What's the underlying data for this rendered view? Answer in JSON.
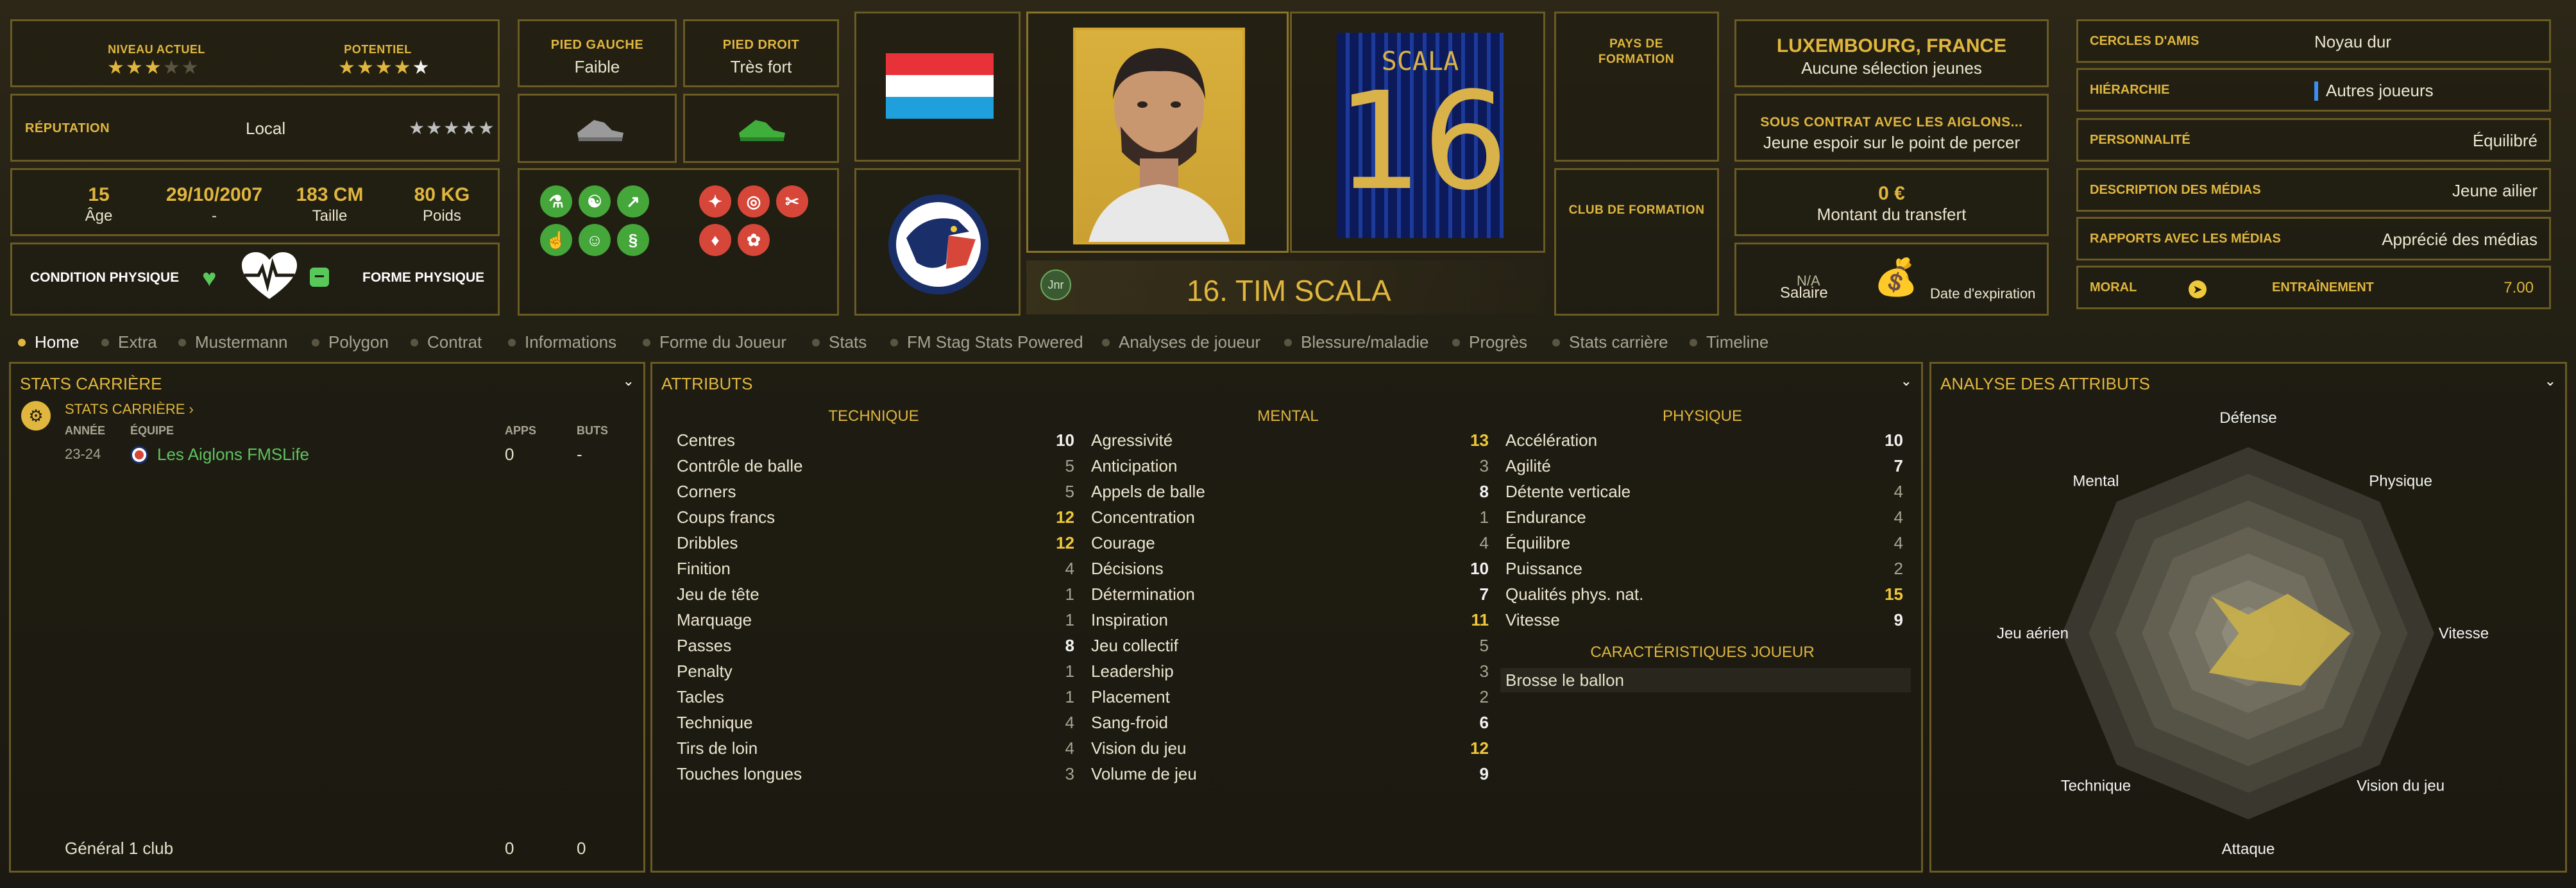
{
  "profile": {
    "current_level_label": "NIVEAU ACTUEL",
    "potential_label": "POTENTIEL",
    "current_level_stars": 3,
    "potential_stars": 4.5,
    "reputation_label": "RÉPUTATION",
    "reputation_value": "Local",
    "reputation_stars": 0,
    "age_value": "15",
    "age_label": "Âge",
    "dob_value": "29/10/2007",
    "dob_label": "-",
    "height_value": "183 CM",
    "height_label": "Taille",
    "weight_value": "80 KG",
    "weight_label": "Poids",
    "condition_label": "CONDITION PHYSIQUE",
    "form_label": "FORME PHYSIQUE",
    "left_foot_label": "PIED GAUCHE",
    "left_foot_value": "Faible",
    "right_foot_label": "PIED DROIT",
    "right_foot_value": "Très fort",
    "training_pref_label": "PAYS DE FORMATION",
    "club_training_label": "CLUB DE FORMATION",
    "nationality_title": "LUXEMBOURG, FRANCE",
    "nationality_sub": "Aucune sélection jeunes",
    "contract_title": "SOUS CONTRAT AVEC LES AIGLONS...",
    "contract_sub": "Jeune espoir sur le point de percer",
    "transfer_value": "0 €",
    "transfer_label": "Montant du transfert",
    "salary_value": "N/A",
    "salary_label": "Salaire",
    "expiry_label": "Date d'expiration",
    "player_name": "16. TIM SCALA",
    "badge": "Jnr",
    "shirt_name": "SCALA",
    "shirt_number": "16",
    "club_badge_text": "LES AIGLONS"
  },
  "right_panel": [
    {
      "k": "CERCLES D'AMIS",
      "v": "Noyau dur"
    },
    {
      "k": "HIÉRARCHIE",
      "v": "Autres joueurs"
    },
    {
      "k": "PERSONNALITÉ",
      "v": "Équilibré"
    },
    {
      "k": "DESCRIPTION DES MÉDIAS",
      "v": "Jeune ailier"
    },
    {
      "k": "RAPPORTS AVEC LES MÉDIAS",
      "v": "Apprécié des médias"
    }
  ],
  "moral": {
    "label": "MORAL",
    "training_label": "ENTRAÎNEMENT",
    "training_value": "7.00"
  },
  "tabs": [
    "Home",
    "Extra",
    "Mustermann",
    "Polygon",
    "Contrat",
    "Informations",
    "Forme du Joueur",
    "Stats",
    "FM Stag Stats Powered",
    "Analyses de joueur",
    "Blessure/maladie",
    "Progrès",
    "Stats carrière",
    "Timeline"
  ],
  "career": {
    "title": "STATS CARRIÈRE",
    "sub": "STATS CARRIÈRE",
    "col_year": "ANNÉE",
    "col_team": "ÉQUIPE",
    "col_apps": "APPS",
    "col_goals": "BUTS",
    "rows": [
      {
        "year": "23-24",
        "team": "Les Aiglons FMSLife",
        "apps": "0",
        "goals": "-"
      }
    ],
    "total_label": "Général 1 club",
    "total_apps": "0",
    "total_goals": "0"
  },
  "attributes": {
    "title": "ATTRIBUTS",
    "tech_label": "TECHNIQUE",
    "mental_label": "MENTAL",
    "phys_label": "PHYSIQUE",
    "technique": [
      [
        "Centres",
        "10"
      ],
      [
        "Contrôle de balle",
        "5"
      ],
      [
        "Corners",
        "5"
      ],
      [
        "Coups francs",
        "12"
      ],
      [
        "Dribbles",
        "12"
      ],
      [
        "Finition",
        "4"
      ],
      [
        "Jeu de tête",
        "1"
      ],
      [
        "Marquage",
        "1"
      ],
      [
        "Passes",
        "8"
      ],
      [
        "Penalty",
        "1"
      ],
      [
        "Tacles",
        "1"
      ],
      [
        "Technique",
        "4"
      ],
      [
        "Tirs de loin",
        "4"
      ],
      [
        "Touches longues",
        "3"
      ]
    ],
    "mental": [
      [
        "Agressivité",
        "13"
      ],
      [
        "Anticipation",
        "3"
      ],
      [
        "Appels de balle",
        "8"
      ],
      [
        "Concentration",
        "1"
      ],
      [
        "Courage",
        "4"
      ],
      [
        "Décisions",
        "10"
      ],
      [
        "Détermination",
        "7"
      ],
      [
        "Inspiration",
        "11"
      ],
      [
        "Jeu collectif",
        "5"
      ],
      [
        "Leadership",
        "3"
      ],
      [
        "Placement",
        "2"
      ],
      [
        "Sang-froid",
        "6"
      ],
      [
        "Vision du jeu",
        "12"
      ],
      [
        "Volume de jeu",
        "9"
      ]
    ],
    "physique": [
      [
        "Accélération",
        "10"
      ],
      [
        "Agilité",
        "7"
      ],
      [
        "Détente verticale",
        "4"
      ],
      [
        "Endurance",
        "4"
      ],
      [
        "Équilibre",
        "4"
      ],
      [
        "Puissance",
        "2"
      ],
      [
        "Qualités phys. nat.",
        "15"
      ],
      [
        "Vitesse",
        "9"
      ]
    ],
    "traits_label": "CARACTÉRISTIQUES JOUEUR",
    "traits": [
      "Brosse le ballon"
    ]
  },
  "analysis": {
    "title": "ANALYSE DES ATTRIBUTS",
    "axes": [
      "Défense",
      "Physique",
      "Vitesse",
      "Vision du jeu",
      "Attaque",
      "Technique",
      "Jeu aérien",
      "Mental"
    ],
    "values": [
      0.1,
      0.3,
      0.55,
      0.4,
      0.25,
      0.3,
      0.05,
      0.28
    ],
    "fill_color": "#c9b04a"
  }
}
